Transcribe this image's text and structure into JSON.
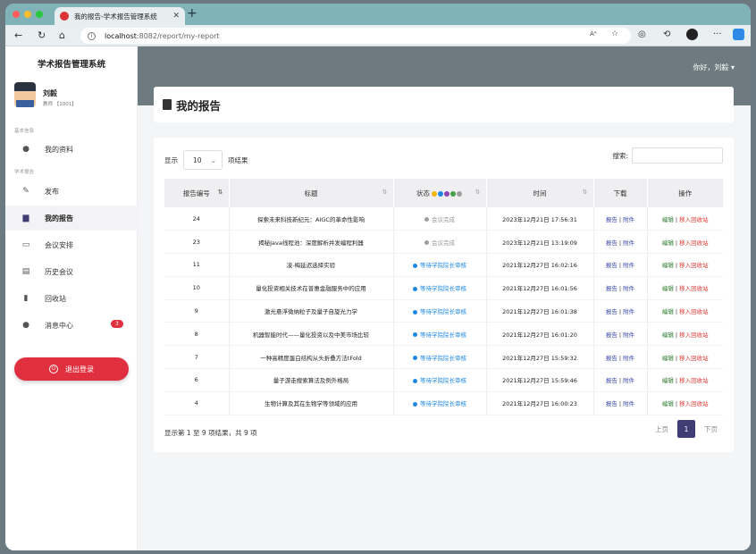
{
  "browser": {
    "tab_title": "我的报告-学术报告管理系统",
    "url_host": "localhost",
    "url_rest": ":8082/report/my-report"
  },
  "sidebar": {
    "brand": "学术报告管理系统",
    "user_name": "刘毅",
    "user_role": "教师 【1001】",
    "section_basic": "基本信息",
    "section_report": "学术报告",
    "items": [
      {
        "label": "我的资料",
        "icon": "person-icon"
      },
      {
        "label": "发布",
        "icon": "edit-icon"
      },
      {
        "label": "我的报告",
        "icon": "book-icon"
      },
      {
        "label": "会议安排",
        "icon": "calendar-icon"
      },
      {
        "label": "历史会议",
        "icon": "history-icon"
      },
      {
        "label": "回收站",
        "icon": "trash-icon"
      },
      {
        "label": "消息中心",
        "icon": "chat-icon",
        "badge": "3"
      }
    ],
    "logout": "退出登录"
  },
  "header": {
    "greeting": "你好，刘毅 ▾"
  },
  "main": {
    "page_title": "我的报告",
    "show_label": "显示",
    "page_length": "10",
    "entries_label": "项结果",
    "search_label": "搜索:",
    "columns": [
      "报告编号",
      "标题",
      "状态",
      "时间",
      "下载",
      "操作"
    ],
    "status_dot_colors": [
      "#f5b400",
      "#1e88e5",
      "#8e44ad",
      "#43a047",
      "#9e9e9e"
    ],
    "rows": [
      {
        "id": "24",
        "title": "探索未来科技新纪元：AIGC的革命性影响",
        "status": "会议完成",
        "status_type": "done",
        "time": "2023年12月21日 17:56:31"
      },
      {
        "id": "23",
        "title": "揭秘Java线程池：深度解析并发编程利器",
        "status": "会议完成",
        "status_type": "done",
        "time": "2023年12月21日 13:19:09"
      },
      {
        "id": "11",
        "title": "凌-梅延迟选择实验",
        "status": "等待学院院长审核",
        "status_type": "wait",
        "time": "2021年12月27日 16:02:16"
      },
      {
        "id": "10",
        "title": "量化投资相关技术在普惠金融服务中的应用",
        "status": "等待学院院长审核",
        "status_type": "wait",
        "time": "2021年12月27日 16:01:56"
      },
      {
        "id": "9",
        "title": "激光悬浮微纳粒子及量子自旋光力学",
        "status": "等待学院院长审核",
        "status_type": "wait",
        "time": "2021年12月27日 16:01:38"
      },
      {
        "id": "8",
        "title": "机器智能时代——量化投资以及中美市场比较",
        "status": "等待学院院长审核",
        "status_type": "wait",
        "time": "2021年12月27日 16:01:20"
      },
      {
        "id": "7",
        "title": "一种高精度蛋白结构从头折叠方法tFold",
        "status": "等待学院院长审核",
        "status_type": "wait",
        "time": "2021年12月27日 15:59:32"
      },
      {
        "id": "6",
        "title": "量子游走搜索算法及例外格局",
        "status": "等待学院院长审核",
        "status_type": "wait",
        "time": "2021年12月27日 15:59:46"
      },
      {
        "id": "4",
        "title": "生物计算及其在生物学等领域的应用",
        "status": "等待学院院长审核",
        "status_type": "wait",
        "time": "2021年12月27日 16:00:23"
      }
    ],
    "download_report": "报告",
    "download_attach": "附件",
    "action_edit": "编辑",
    "action_trash": "移入回收站",
    "footer_info": "显示第 1 至 9 项结果，共 9 项",
    "prev": "上页",
    "page": "1",
    "next": "下页"
  }
}
